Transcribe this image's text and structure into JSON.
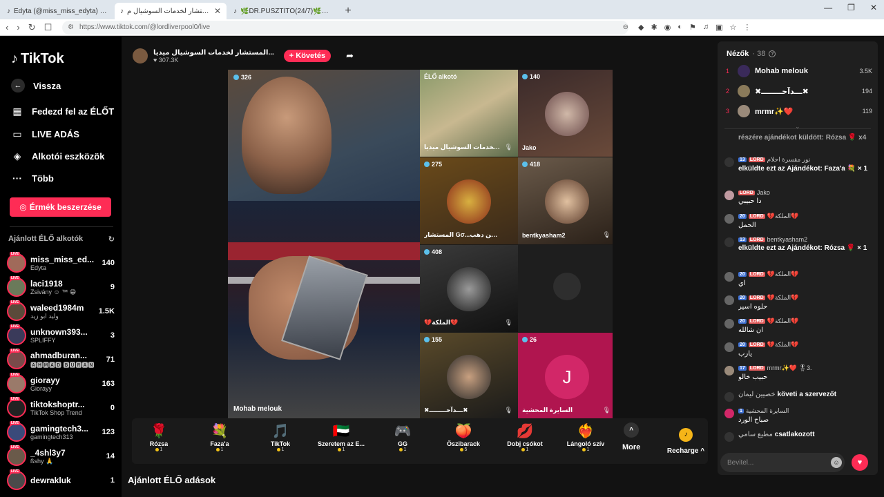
{
  "browser": {
    "tabs": [
      {
        "title": "Edyta (@miss_miss_edyta) ÉLŐ a..."
      },
      {
        "title": "المستشار لخدمات السوشيال م..."
      },
      {
        "title": "🌿DR.PUSZTÍTÓ(24/7)🌿🎈🌿🎸"
      }
    ],
    "url": "https://www.tiktok.com/@lordliverpool0/live"
  },
  "sidebar": {
    "logo": "TikTok",
    "back": "Vissza",
    "nav": [
      "Fedezd fel az ÉLŐT",
      "LIVE ADÁS",
      "Alkotói eszközök",
      "Több"
    ],
    "coins_button": "Érmék beszerzése",
    "recommended_title": "Ajánlott ÉLŐ alkotók",
    "creators": [
      {
        "handle": "miss_miss_ed...",
        "sub": "Edyta",
        "count": "140"
      },
      {
        "handle": "laci1918",
        "sub": "Zsivány ☺ ™ 😁",
        "count": "9"
      },
      {
        "handle": "waleed1984m",
        "sub": "وليد ابو زيد",
        "count": "1.5K"
      },
      {
        "handle": "unknown393...",
        "sub": "SPLIFFY",
        "count": "3"
      },
      {
        "handle": "ahmadburan...",
        "sub": "🅰🅷🅼🅰🅳 🅱🆄🆁🅰🅽",
        "count": "71"
      },
      {
        "handle": "giorayy",
        "sub": "Giorayy",
        "count": "163"
      },
      {
        "handle": "tiktokshoptr...",
        "sub": "TikTok Shop Trend",
        "count": "0"
      },
      {
        "handle": "gamingtech3...",
        "sub": "gamingtech313",
        "count": "123"
      },
      {
        "handle": "_4shl3y7",
        "sub": "ßshy 🙏",
        "count": "14"
      },
      {
        "handle": "dewrakluk",
        "sub": "",
        "count": "1"
      }
    ]
  },
  "host": {
    "name": "المستشار لخدمات السوشيال ميديا...",
    "likes": "307.3K",
    "follow": "+ Követés"
  },
  "video": {
    "main": {
      "count": "326",
      "label": "Mohab melouk"
    },
    "tiles": [
      {
        "count": "ÉLŐ alkotó",
        "label": "المستشار لخدمات السوشيال ميديا"
      },
      {
        "count": "140",
        "label": "Jako"
      },
      {
        "count": "275",
        "label": "المستشار Gσ...ـروز من دهب"
      },
      {
        "count": "418",
        "label": "bentkyasham2"
      },
      {
        "count": "408",
        "label": "💔الملكة💔"
      },
      {
        "count": "",
        "label": ""
      },
      {
        "count": "155",
        "label": "✖ـــدآحــــــــ✖"
      },
      {
        "count": "26",
        "label": "السايرة المحشية"
      }
    ]
  },
  "gifts": [
    {
      "name": "Rózsa",
      "price": "1",
      "icon": "🌹"
    },
    {
      "name": "Faza'a",
      "price": "1",
      "icon": "💐"
    },
    {
      "name": "TikTok",
      "price": "1",
      "icon": "🎵"
    },
    {
      "name": "Szeretem az E...",
      "price": "1",
      "icon": "🇦🇪"
    },
    {
      "name": "GG",
      "price": "1",
      "icon": "🎮"
    },
    {
      "name": "Őszibarack",
      "price": "5",
      "icon": "🍑"
    },
    {
      "name": "Dobj csókot",
      "price": "1",
      "icon": "💋"
    },
    {
      "name": "Lángoló szív",
      "price": "1",
      "icon": "❤️‍🔥"
    }
  ],
  "more_label": "More",
  "recharge_label": "Recharge",
  "section_title": "Ajánlott ÉLŐ adások",
  "chat": {
    "viewers_label": "Nézők",
    "viewers_count": "· 38",
    "top": [
      {
        "rank": "1",
        "name": "Mohab melouk",
        "value": "3.5K"
      },
      {
        "rank": "2",
        "name": "✖ـــدآحــــــــ✖",
        "value": "194"
      },
      {
        "rank": "3",
        "name": "mrmr✨❤️",
        "value": "119"
      }
    ],
    "messages": [
      {
        "head": "",
        "text": "részére ajándékot küldött: Rózsa 🌹 x4"
      },
      {
        "head": "نور مقسرة احلام",
        "lvl": "13",
        "text": "elküldte ezt az Ajándékot: Faza'a 💐 × 1"
      },
      {
        "head": "Jako",
        "lvl": "",
        "text": "دا حبيبي"
      },
      {
        "head": "💔الملكة💔",
        "lvl": "20",
        "text": "الحمل"
      },
      {
        "head": "bentkyasham2",
        "lvl": "13",
        "text": "elküldte ezt az Ajándékot: Rózsa 🌹 × 1"
      },
      {
        "head": "💔الملكة💔",
        "lvl": "20",
        "text": "اي"
      },
      {
        "head": "💔الملكة💔",
        "lvl": "20",
        "text": "حلوه اسير"
      },
      {
        "head": "💔الملكة💔",
        "lvl": "20",
        "text": "ان شالله"
      },
      {
        "head": "💔الملكة💔",
        "lvl": "20",
        "text": "يارب"
      },
      {
        "head": "mrmr✨❤️ 🎖3.",
        "lvl": "17",
        "text": "حبيب خالو"
      },
      {
        "head": "خصيين ليمان",
        "lvl": "",
        "text": "követi a szervezőt"
      },
      {
        "head": "السايرة المحشية",
        "lvl": "1",
        "text": "صباح الورد"
      },
      {
        "head": "مطيع سامي",
        "lvl": "",
        "text": "csatlakozott"
      }
    ],
    "input_placeholder": "Bevitel..."
  }
}
